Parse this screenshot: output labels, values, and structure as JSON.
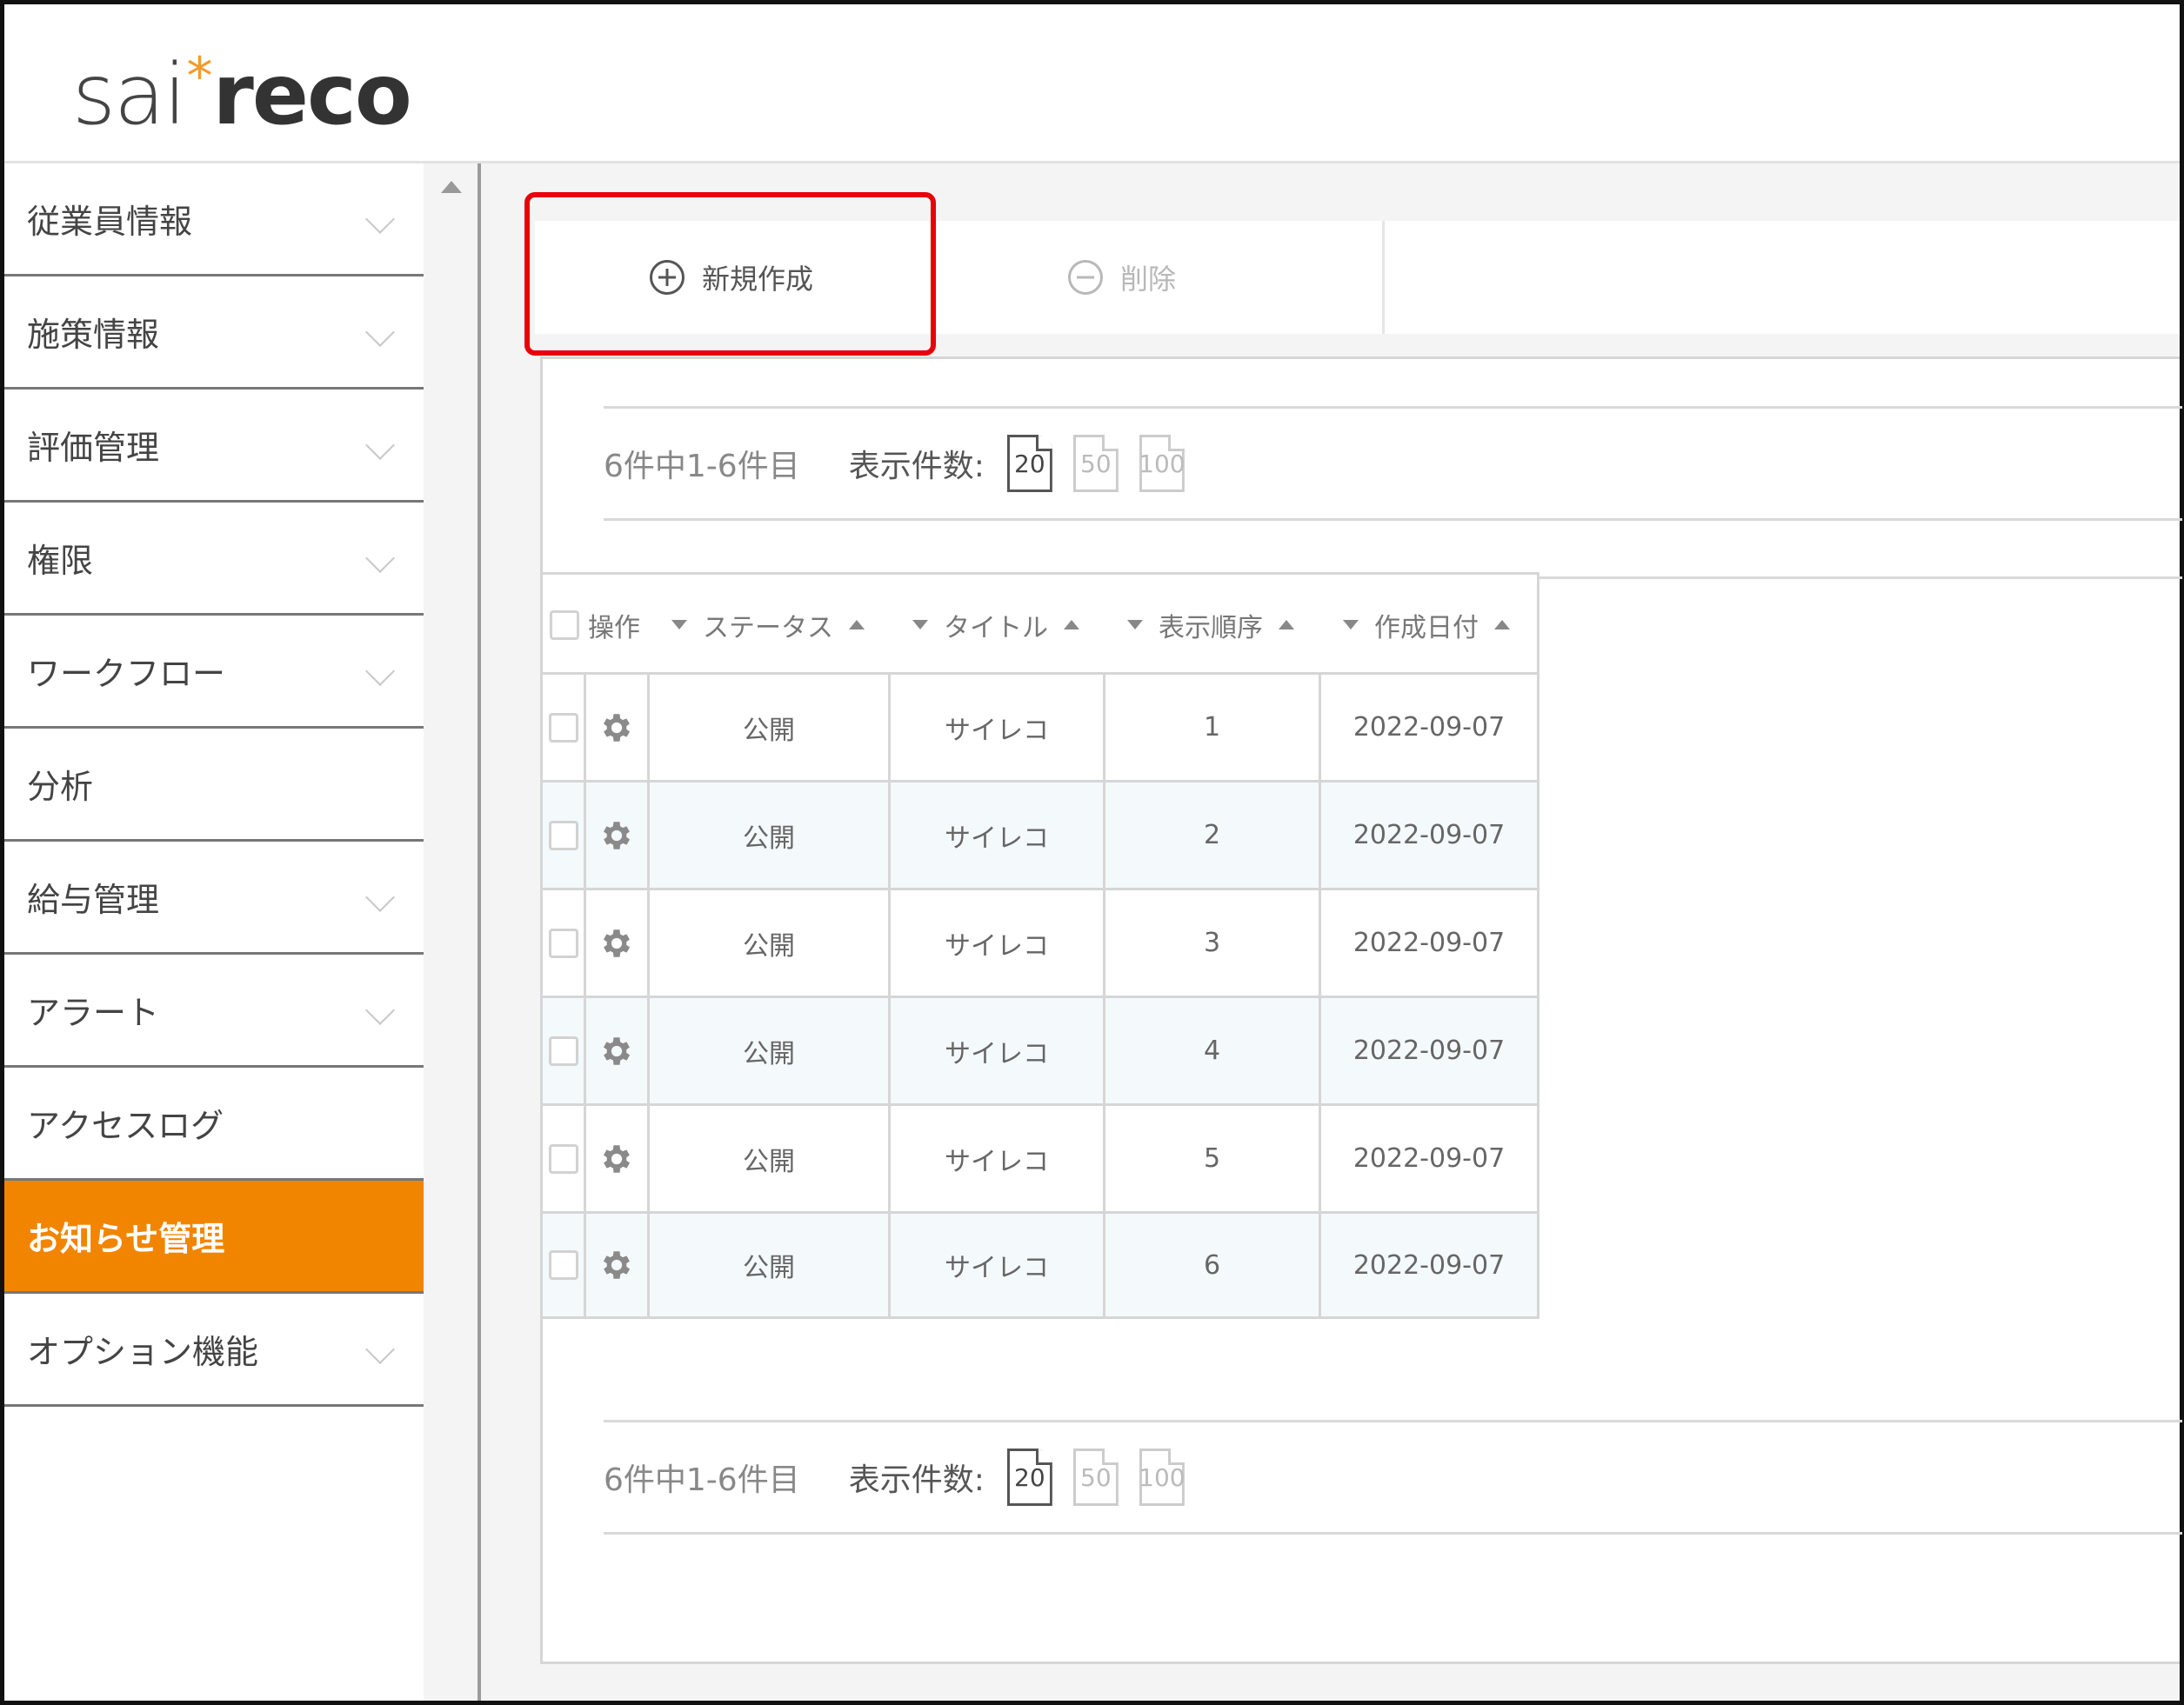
{
  "logo": {
    "part1": "sai",
    "star": "*",
    "part2": "reco"
  },
  "sidebar": {
    "items": [
      {
        "label": "従業員情報",
        "expandable": true
      },
      {
        "label": "施策情報",
        "expandable": true
      },
      {
        "label": "評価管理",
        "expandable": true
      },
      {
        "label": "権限",
        "expandable": true
      },
      {
        "label": "ワークフロー",
        "expandable": true
      },
      {
        "label": "分析",
        "expandable": false
      },
      {
        "label": "給与管理",
        "expandable": true
      },
      {
        "label": "アラート",
        "expandable": true
      },
      {
        "label": "アクセスログ",
        "expandable": false
      },
      {
        "label": "お知らせ管理",
        "expandable": false,
        "active": true
      },
      {
        "label": "オプション機能",
        "expandable": true
      }
    ]
  },
  "toolbar": {
    "new_label": "新規作成",
    "delete_label": "削除"
  },
  "pager": {
    "count_text": "6件中1-6件目",
    "per_page_label": "表示件数:",
    "options": [
      "20",
      "50",
      "100"
    ],
    "selected": "20"
  },
  "table": {
    "headers": {
      "action": "操作",
      "status": "ステータス",
      "title": "タイトル",
      "order": "表示順序",
      "date": "作成日付"
    },
    "rows": [
      {
        "status": "公開",
        "title": "サイレコ",
        "order": "1",
        "date": "2022-09-07"
      },
      {
        "status": "公開",
        "title": "サイレコ",
        "order": "2",
        "date": "2022-09-07"
      },
      {
        "status": "公開",
        "title": "サイレコ",
        "order": "3",
        "date": "2022-09-07"
      },
      {
        "status": "公開",
        "title": "サイレコ",
        "order": "4",
        "date": "2022-09-07"
      },
      {
        "status": "公開",
        "title": "サイレコ",
        "order": "5",
        "date": "2022-09-07"
      },
      {
        "status": "公開",
        "title": "サイレコ",
        "order": "6",
        "date": "2022-09-07"
      }
    ]
  },
  "colors": {
    "accent": "#f28500",
    "highlight": "#e8000b",
    "logo_star": "#f39a2b"
  },
  "icons": {
    "new": "plus-circle-icon",
    "delete": "minus-circle-icon",
    "row_action": "gear-icon"
  }
}
